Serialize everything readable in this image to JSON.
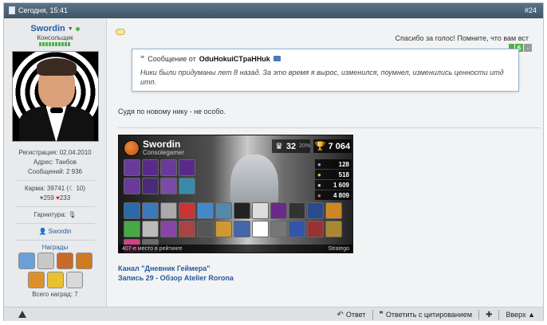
{
  "header": {
    "date": "Сегодня, 15:41",
    "post_number": "#24"
  },
  "user": {
    "name": "Swordin",
    "title": "Консольщик",
    "registration": "Регистрация: 02.04.2010",
    "address": "Адрес: Танбов",
    "messages": "Сообщений: 2 936",
    "karma": "Карма: 39741 (",
    "karma_count": "10)",
    "likes_blue": "259",
    "likes_red": "233",
    "guarantor": "Гарнитура:",
    "site_link": "Swordin",
    "awards_title": "Награды",
    "awards_total": "Всего наград: 7",
    "award_colors": [
      "#6aa0d8",
      "#c8c8c8",
      "#c86a2a",
      "#d07a20",
      "#e0902a",
      "#e8c030",
      "#d8d8d8"
    ],
    "accent": "#2a5a9a"
  },
  "content": {
    "thanks": "Спасибо за голос! Помните, что вам вст",
    "vote_minus": "-",
    "vote_value": "6",
    "quote": {
      "prefix": "Сообщение от",
      "author": "OduHokuiCTpaHHuk",
      "text": "Ники были придуманы лет 8 назад. За это время я вырос, изменился, поумнел, изменились ценности итд итп."
    },
    "reply": "Судя по новому нику - не особо.",
    "card": {
      "name": "Swordin",
      "sub": "Consolegamer",
      "level": "32",
      "level_pct": "20%",
      "trophies": "7 064",
      "stats": [
        "128",
        "518",
        "1 609",
        "4 809"
      ],
      "footer_left": "407-е место в рейтинге",
      "footer_right": "Stratego",
      "tiles_row1": [
        "#6a3a9a",
        "#5a2a8a",
        "#6a3a9a",
        "#5a2a8a",
        "#6a3a9a",
        "#4a2a7a",
        "#7a4aaa",
        "#3a8aaa"
      ],
      "tiles_row2": [
        "#2a6aaa",
        "#3a7aba",
        "#aaaaaa",
        "#cc3333",
        "#4488cc",
        "#5588aa",
        "#222222",
        "#dddddd",
        "#6a2a8a",
        "#333333",
        "#2a4a8a",
        "#cc8822",
        "#44aa44",
        "#bbbbbb",
        "#8844aa",
        "#aa4444",
        "#555555",
        "#cc9933",
        "#4466aa",
        "#ffffff",
        "#777777",
        "#3355aa",
        "#993333",
        "#aa8833",
        "#cc4488",
        "#6a6a6a"
      ]
    },
    "link1": "Канал \"Дневник Геймера\"",
    "link2": "Запись 29 - Обзор Atelier Rorona"
  },
  "footer": {
    "reply_label": "Ответ",
    "quote_label": "Ответить с цитированием",
    "up_label": "Вверх ▲"
  }
}
